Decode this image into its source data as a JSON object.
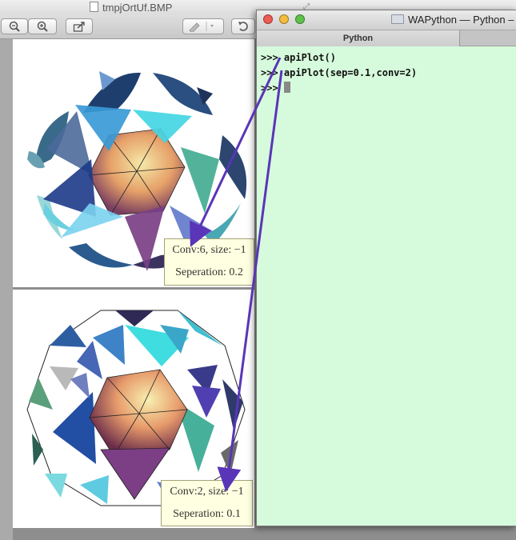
{
  "preview": {
    "filename": "tmpjOrtUf.BMP",
    "toolbar": {
      "zoom_out_icon": "zoom-out-icon",
      "zoom_in_icon": "zoom-in-icon",
      "share_icon": "share-icon",
      "annotate_icon": "pen-icon",
      "rotate_icon": "rotate-icon"
    },
    "captions": [
      {
        "line1": "Conv:6, size: −1",
        "line2": "Seperation: 0.2"
      },
      {
        "line1": "Conv:2, size: −1",
        "line2": "Seperation: 0.1"
      }
    ]
  },
  "python_window": {
    "title": "WAPython — Python –",
    "tab_label": "Python",
    "prompt": ">>>",
    "console_lines": [
      {
        "prompt": ">>>",
        "text": " apiPlot()"
      },
      {
        "prompt": ">>>",
        "text": " apiPlot(sep=0.1,conv=2)"
      },
      {
        "prompt": ">>>",
        "text": " "
      }
    ]
  },
  "colors": {
    "console_bg": "#d6fbdc",
    "arrow": "#5a35b8",
    "caption_bg": "#ffffe1",
    "close_light": "#ee5b52",
    "minimize_light": "#f4bc3c",
    "zoom_light": "#5ec24a"
  }
}
